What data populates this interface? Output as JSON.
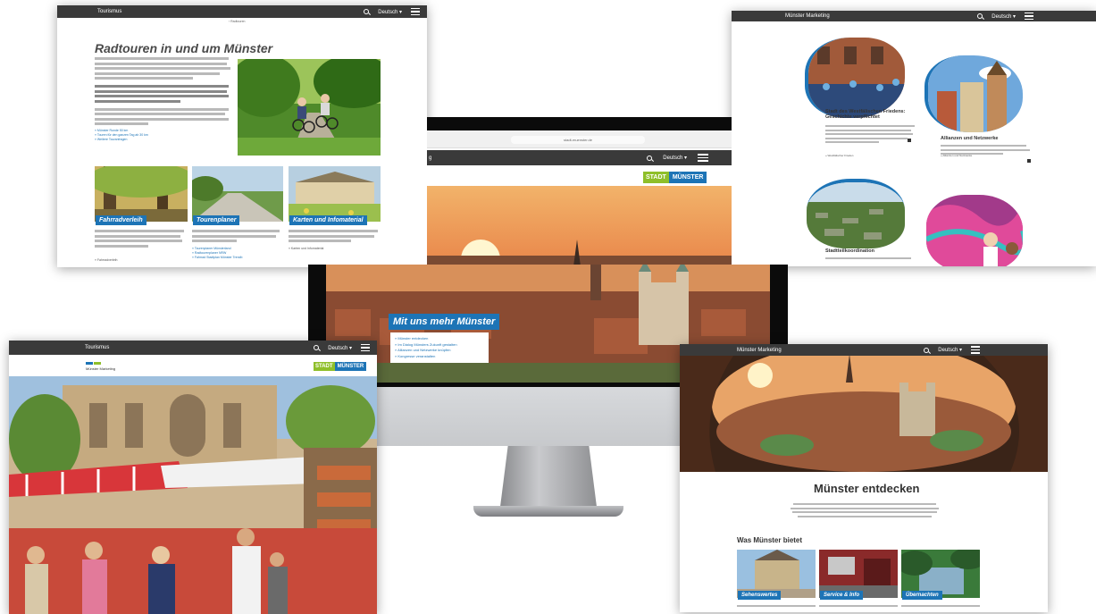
{
  "common": {
    "lang_label": "Deutsch ▾",
    "brand_tourismus": "Tourismus",
    "brand_marketing": "Münster Marketing",
    "logo_stadt": "STADT",
    "logo_muenster": "MÜNSTER"
  },
  "p1": {
    "breadcrumb": "› Radtouren",
    "title": "Radtouren in und um Münster",
    "links": [
      "» Münster Runde 50 km",
      "» Touren für den ganzen Tag ab 30 km",
      "» Weitere Touranfragen"
    ],
    "cards": [
      {
        "label": "Fahrradverleih",
        "link": "» Fahrradverleih"
      },
      {
        "label": "Tourenplaner",
        "links": [
          "» Tourenplaner Münsterland",
          "» Radtourenplaner NRW",
          "» Fahrrad Stadtplan Münster Trendb"
        ]
      },
      {
        "label": "Karten und Infomaterial",
        "link": "» Karten und Infomaterial"
      }
    ]
  },
  "p2": {
    "url": "stadt-muenster.de",
    "topbar_brand": "g",
    "hero_tag": "Mit uns mehr Münster",
    "links": [
      "» Münster entdecken",
      "» Im Dialog Münsters Zukunft gestalten",
      "» Allianzen und Netzwerke knüpfen",
      "» Kongresse veranstalten"
    ]
  },
  "p3": {
    "cards": [
      {
        "title": "Stadt des Westfälischen Friedens: Geschichte verpflichtet",
        "link": "» Westfälischer Frieden"
      },
      {
        "title": "Allianzen und Netzwerke",
        "link": "» Allianzen und Netzwerke"
      },
      {
        "title": "Stadtteilkoordination"
      }
    ]
  },
  "p5": {
    "title": "Münster entdecken",
    "section": "Was Münster bietet",
    "cards": [
      "Sehenswertes",
      "Service & Info",
      "Übernachten"
    ]
  }
}
